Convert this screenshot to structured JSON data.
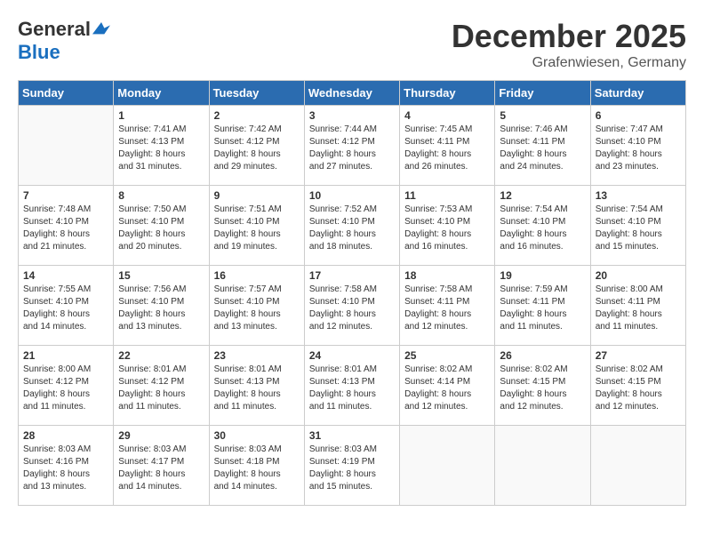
{
  "header": {
    "logo_general": "General",
    "logo_blue": "Blue",
    "month_year": "December 2025",
    "location": "Grafenwiesen, Germany"
  },
  "weekdays": [
    "Sunday",
    "Monday",
    "Tuesday",
    "Wednesday",
    "Thursday",
    "Friday",
    "Saturday"
  ],
  "weeks": [
    [
      {
        "day": null,
        "info": null
      },
      {
        "day": "1",
        "info": "Sunrise: 7:41 AM\nSunset: 4:13 PM\nDaylight: 8 hours\nand 31 minutes."
      },
      {
        "day": "2",
        "info": "Sunrise: 7:42 AM\nSunset: 4:12 PM\nDaylight: 8 hours\nand 29 minutes."
      },
      {
        "day": "3",
        "info": "Sunrise: 7:44 AM\nSunset: 4:12 PM\nDaylight: 8 hours\nand 27 minutes."
      },
      {
        "day": "4",
        "info": "Sunrise: 7:45 AM\nSunset: 4:11 PM\nDaylight: 8 hours\nand 26 minutes."
      },
      {
        "day": "5",
        "info": "Sunrise: 7:46 AM\nSunset: 4:11 PM\nDaylight: 8 hours\nand 24 minutes."
      },
      {
        "day": "6",
        "info": "Sunrise: 7:47 AM\nSunset: 4:10 PM\nDaylight: 8 hours\nand 23 minutes."
      }
    ],
    [
      {
        "day": "7",
        "info": "Sunrise: 7:48 AM\nSunset: 4:10 PM\nDaylight: 8 hours\nand 21 minutes."
      },
      {
        "day": "8",
        "info": "Sunrise: 7:50 AM\nSunset: 4:10 PM\nDaylight: 8 hours\nand 20 minutes."
      },
      {
        "day": "9",
        "info": "Sunrise: 7:51 AM\nSunset: 4:10 PM\nDaylight: 8 hours\nand 19 minutes."
      },
      {
        "day": "10",
        "info": "Sunrise: 7:52 AM\nSunset: 4:10 PM\nDaylight: 8 hours\nand 18 minutes."
      },
      {
        "day": "11",
        "info": "Sunrise: 7:53 AM\nSunset: 4:10 PM\nDaylight: 8 hours\nand 16 minutes."
      },
      {
        "day": "12",
        "info": "Sunrise: 7:54 AM\nSunset: 4:10 PM\nDaylight: 8 hours\nand 16 minutes."
      },
      {
        "day": "13",
        "info": "Sunrise: 7:54 AM\nSunset: 4:10 PM\nDaylight: 8 hours\nand 15 minutes."
      }
    ],
    [
      {
        "day": "14",
        "info": "Sunrise: 7:55 AM\nSunset: 4:10 PM\nDaylight: 8 hours\nand 14 minutes."
      },
      {
        "day": "15",
        "info": "Sunrise: 7:56 AM\nSunset: 4:10 PM\nDaylight: 8 hours\nand 13 minutes."
      },
      {
        "day": "16",
        "info": "Sunrise: 7:57 AM\nSunset: 4:10 PM\nDaylight: 8 hours\nand 13 minutes."
      },
      {
        "day": "17",
        "info": "Sunrise: 7:58 AM\nSunset: 4:10 PM\nDaylight: 8 hours\nand 12 minutes."
      },
      {
        "day": "18",
        "info": "Sunrise: 7:58 AM\nSunset: 4:11 PM\nDaylight: 8 hours\nand 12 minutes."
      },
      {
        "day": "19",
        "info": "Sunrise: 7:59 AM\nSunset: 4:11 PM\nDaylight: 8 hours\nand 11 minutes."
      },
      {
        "day": "20",
        "info": "Sunrise: 8:00 AM\nSunset: 4:11 PM\nDaylight: 8 hours\nand 11 minutes."
      }
    ],
    [
      {
        "day": "21",
        "info": "Sunrise: 8:00 AM\nSunset: 4:12 PM\nDaylight: 8 hours\nand 11 minutes."
      },
      {
        "day": "22",
        "info": "Sunrise: 8:01 AM\nSunset: 4:12 PM\nDaylight: 8 hours\nand 11 minutes."
      },
      {
        "day": "23",
        "info": "Sunrise: 8:01 AM\nSunset: 4:13 PM\nDaylight: 8 hours\nand 11 minutes."
      },
      {
        "day": "24",
        "info": "Sunrise: 8:01 AM\nSunset: 4:13 PM\nDaylight: 8 hours\nand 11 minutes."
      },
      {
        "day": "25",
        "info": "Sunrise: 8:02 AM\nSunset: 4:14 PM\nDaylight: 8 hours\nand 12 minutes."
      },
      {
        "day": "26",
        "info": "Sunrise: 8:02 AM\nSunset: 4:15 PM\nDaylight: 8 hours\nand 12 minutes."
      },
      {
        "day": "27",
        "info": "Sunrise: 8:02 AM\nSunset: 4:15 PM\nDaylight: 8 hours\nand 12 minutes."
      }
    ],
    [
      {
        "day": "28",
        "info": "Sunrise: 8:03 AM\nSunset: 4:16 PM\nDaylight: 8 hours\nand 13 minutes."
      },
      {
        "day": "29",
        "info": "Sunrise: 8:03 AM\nSunset: 4:17 PM\nDaylight: 8 hours\nand 14 minutes."
      },
      {
        "day": "30",
        "info": "Sunrise: 8:03 AM\nSunset: 4:18 PM\nDaylight: 8 hours\nand 14 minutes."
      },
      {
        "day": "31",
        "info": "Sunrise: 8:03 AM\nSunset: 4:19 PM\nDaylight: 8 hours\nand 15 minutes."
      },
      {
        "day": null,
        "info": null
      },
      {
        "day": null,
        "info": null
      },
      {
        "day": null,
        "info": null
      }
    ]
  ]
}
